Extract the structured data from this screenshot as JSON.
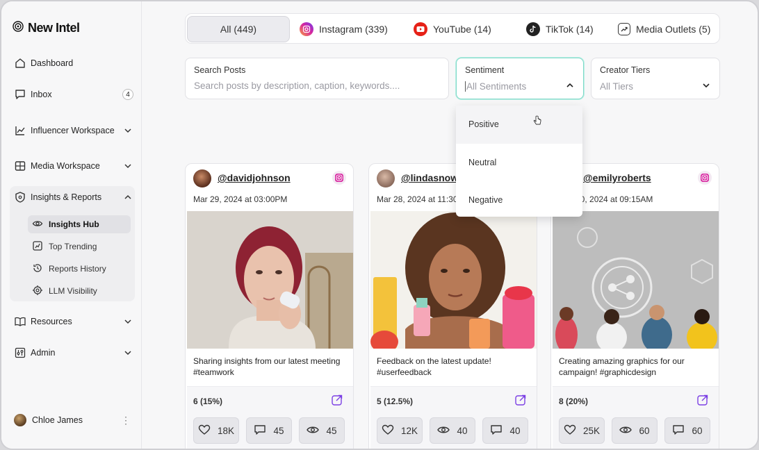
{
  "app": {
    "name": "New Intel"
  },
  "sidebar": {
    "items": [
      {
        "label": "Dashboard",
        "icon": "home-icon"
      },
      {
        "label": "Inbox",
        "icon": "chat-icon",
        "badge": "4"
      },
      {
        "label": "Influencer Workspace",
        "icon": "chart-line-icon"
      },
      {
        "label": "Media Workspace",
        "icon": "media-icon"
      },
      {
        "label": "Insights & Reports",
        "icon": "shield-icon"
      },
      {
        "label": "Resources",
        "icon": "book-icon"
      },
      {
        "label": "Admin",
        "icon": "sliders-icon"
      }
    ],
    "sub_items": [
      {
        "label": "Insights Hub",
        "icon": "eye-icon"
      },
      {
        "label": "Top Trending",
        "icon": "trend-icon"
      },
      {
        "label": "Reports History",
        "icon": "history-icon"
      },
      {
        "label": "LLM Visibility",
        "icon": "chip-icon"
      }
    ],
    "user": {
      "name": "Chloe James"
    }
  },
  "tabs": [
    {
      "label": "All (449)"
    },
    {
      "label": "Instagram (339)"
    },
    {
      "label": "YouTube (14)"
    },
    {
      "label": "TikTok (14)"
    },
    {
      "label": "Media Outlets (5)"
    }
  ],
  "filters": {
    "search": {
      "label": "Search Posts",
      "placeholder": "Search posts by description, caption, keywords...."
    },
    "sentiment": {
      "label": "Sentiment",
      "value": "All Sentiments",
      "options": [
        "Positive",
        "Neutral",
        "Negative"
      ]
    },
    "tiers": {
      "label": "Creator Tiers",
      "value": "All Tiers"
    }
  },
  "posts": [
    {
      "handle": "@davidjohnson",
      "date": "Mar 29, 2024 at 03:00PM",
      "caption": "Sharing insights from our latest meeting #teamwork",
      "sentiment": "6 (15%)",
      "likes": "18K",
      "comments": "45",
      "views": "45"
    },
    {
      "handle": "@lindasnow",
      "date": "Mar 28, 2024 at 11:30AM",
      "caption": "Feedback on the latest update! #userfeedback",
      "sentiment": "5 (12.5%)",
      "likes": "12K",
      "views": "40",
      "comments": "40"
    },
    {
      "handle": "@emilyroberts",
      "date": "Mar 30, 2024 at 09:15AM",
      "caption": "Creating amazing graphics for our campaign! #graphicdesign",
      "sentiment": "8 (20%)",
      "likes": "25K",
      "views": "60",
      "comments": "60"
    }
  ],
  "colors": {
    "accent": "#7b3fe4",
    "focus": "#7fd9c8",
    "instagram": "#d6249f",
    "youtube": "#e62117"
  }
}
